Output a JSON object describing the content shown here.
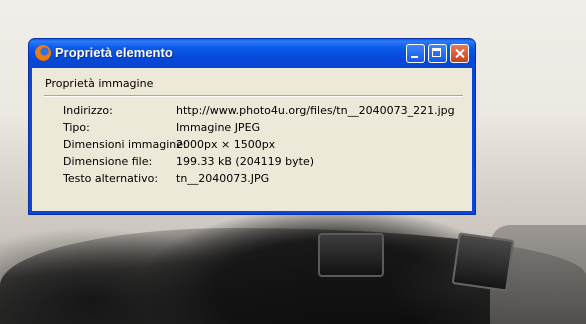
{
  "window": {
    "title": "Proprietà elemento"
  },
  "section": {
    "label": "Proprietà immagine"
  },
  "properties": [
    {
      "key": "Indirizzo:",
      "value": "http://www.photo4u.org/files/tn__2040073_221.jpg"
    },
    {
      "key": "Tipo:",
      "value": "Immagine JPEG"
    },
    {
      "key": "Dimensioni immagine:",
      "value": "2000px × 1500px"
    },
    {
      "key": "Dimensione file:",
      "value": "199.33 kB (204119 byte)"
    },
    {
      "key": "Testo alternativo:",
      "value": "tn__2040073.JPG"
    }
  ],
  "icons": {
    "app": "firefox-icon",
    "minimize": "minimize-icon",
    "maximize": "maximize-icon",
    "close": "close-icon"
  }
}
